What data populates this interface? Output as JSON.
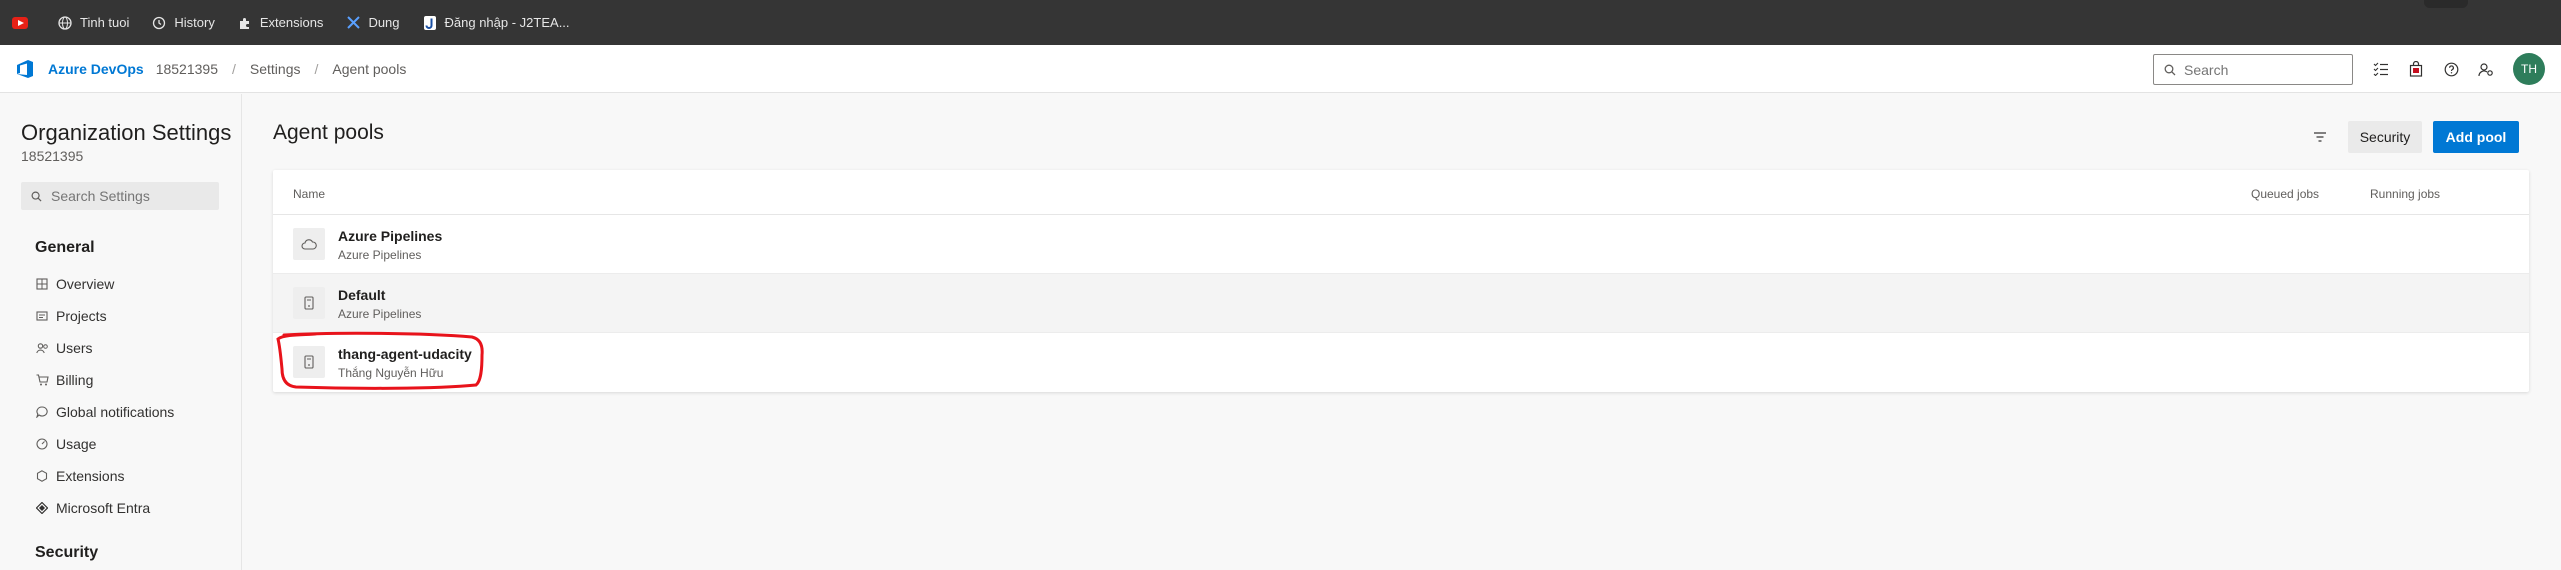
{
  "bookmarks": [
    {
      "label": "",
      "icon": "youtube-icon"
    },
    {
      "label": "Tinh tuoi",
      "icon": "globe-icon"
    },
    {
      "label": "History",
      "icon": "history-icon"
    },
    {
      "label": "Extensions",
      "icon": "puzzle-icon"
    },
    {
      "label": "Dung",
      "icon": "x-logo-icon"
    },
    {
      "label": "Đăng nhập - J2TEA...",
      "icon": "j2team-icon"
    }
  ],
  "header": {
    "brand": "Azure DevOps",
    "org_id": "18521395",
    "crumb_settings": "Settings",
    "crumb_page": "Agent pools",
    "separator": "/",
    "search_placeholder": "Search",
    "avatar_initials": "TH"
  },
  "sidebar": {
    "title": "Organization Settings",
    "org_id": "18521395",
    "search_placeholder": "Search Settings",
    "group_general": "General",
    "items": [
      {
        "label": "Overview",
        "icon": "grid-icon"
      },
      {
        "label": "Projects",
        "icon": "projects-icon"
      },
      {
        "label": "Users",
        "icon": "users-icon"
      },
      {
        "label": "Billing",
        "icon": "cart-icon"
      },
      {
        "label": "Global notifications",
        "icon": "chat-icon"
      },
      {
        "label": "Usage",
        "icon": "gauge-icon"
      },
      {
        "label": "Extensions",
        "icon": "hexagon-icon"
      },
      {
        "label": "Microsoft Entra",
        "icon": "entra-icon"
      }
    ],
    "group_security": "Security"
  },
  "main": {
    "title": "Agent pools",
    "security_label": "Security",
    "add_pool_label": "Add pool",
    "columns": {
      "name": "Name",
      "queued": "Queued jobs",
      "running": "Running jobs"
    },
    "pools": [
      {
        "name": "Azure Pipelines",
        "subtitle": "Azure Pipelines",
        "icon": "cloud-icon"
      },
      {
        "name": "Default",
        "subtitle": "Azure Pipelines",
        "icon": "server-icon"
      },
      {
        "name": "thang-agent-udacity",
        "subtitle": "Thắng Nguyễn Hữu",
        "icon": "server-icon"
      }
    ]
  },
  "colors": {
    "accent": "#0078d4",
    "annotation": "#e8131b",
    "avatar": "#2e7d5b"
  }
}
